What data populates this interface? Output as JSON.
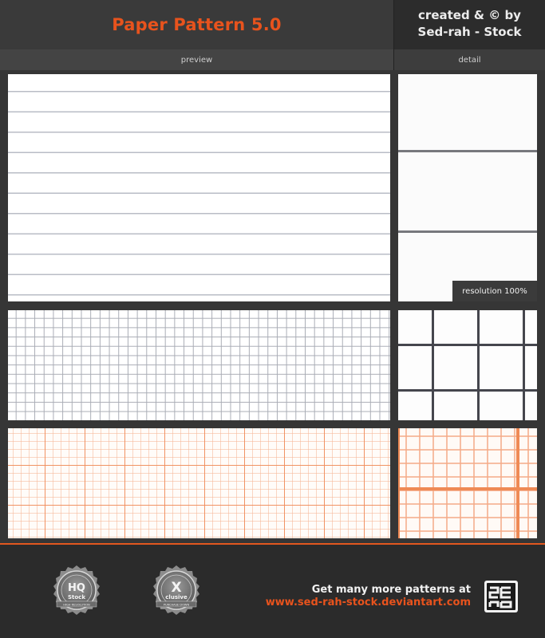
{
  "header": {
    "title": "Paper Pattern 5.0",
    "credit_line1": "created & © by",
    "credit_line2": "Sed-rah - Stock"
  },
  "columns": {
    "preview": "preview",
    "detail": "detail"
  },
  "detail_badge": "resolution 100%",
  "patterns": [
    {
      "name": "lined",
      "colors": {
        "line": "#b9bcc6"
      }
    },
    {
      "name": "grid",
      "colors": {
        "line": "#a9acb5"
      }
    },
    {
      "name": "millimeter",
      "colors": {
        "line": "#ef8a55"
      }
    }
  ],
  "badges": {
    "hq": {
      "top": "HIGH QUALITY",
      "main": "HQ",
      "sub": "Stock",
      "ribbon": "HIGH RESOLUTION",
      "bottom": "Sed-rah-Stock"
    },
    "exclusive": {
      "top": "EXCLUSIVE CONTENT",
      "main": "X",
      "sub": "clusive",
      "ribbon": "PURCHASE DOWN",
      "bottom": "Sed-rah-Stock"
    }
  },
  "footer": {
    "promo_text": "Get many more patterns at",
    "promo_url": "www.sed-rah-stock.deviantart.com",
    "logo_icon": "sed-rah-logo-icon"
  },
  "colors": {
    "accent": "#e8531d",
    "background": "#363636",
    "footer": "#2b2b2b"
  }
}
